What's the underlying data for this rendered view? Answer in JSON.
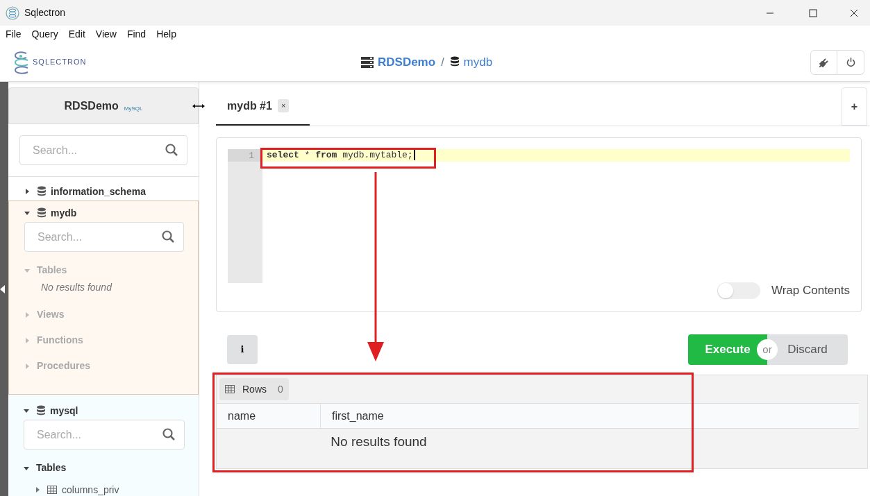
{
  "window": {
    "title": "Sqlectron"
  },
  "menu": [
    "File",
    "Query",
    "Edit",
    "View",
    "Find",
    "Help"
  ],
  "header": {
    "logo_text": "SQLECTRON",
    "breadcrumb": [
      {
        "label": "RDSDemo",
        "kind": "server"
      },
      {
        "label": "mydb",
        "kind": "database"
      }
    ],
    "separator": "/"
  },
  "sidebar": {
    "server": "RDSDemo",
    "db_logo": "MySQL",
    "search": {
      "placeholder": "Search..."
    },
    "databases": [
      {
        "name": "information_schema",
        "expanded": false,
        "selected": false,
        "hovered": false
      },
      {
        "name": "mydb",
        "expanded": true,
        "selected": true,
        "hovered": false,
        "search": {
          "placeholder": "Search..."
        },
        "children": [
          {
            "label": "Tables",
            "expanded": true,
            "disabled": true,
            "empty_text": "No results found"
          },
          {
            "label": "Views",
            "expanded": false,
            "disabled": true
          },
          {
            "label": "Functions",
            "expanded": false,
            "disabled": true
          },
          {
            "label": "Procedures",
            "expanded": false,
            "disabled": true
          }
        ]
      },
      {
        "name": "mysql",
        "expanded": true,
        "selected": false,
        "hovered": true,
        "search": {
          "placeholder": "Search..."
        },
        "children": [
          {
            "label": "Tables",
            "expanded": true,
            "disabled": false,
            "children": [
              {
                "label": "columns_priv",
                "expanded": false
              }
            ]
          }
        ]
      }
    ]
  },
  "tabs": [
    {
      "label": "mydb #1",
      "selected": true,
      "close": "×"
    }
  ],
  "new_tab": "+",
  "editor": {
    "lines": [
      {
        "number": "1",
        "code": "**select** * **from** mydb.mytable;",
        "active": true
      }
    ],
    "wrap_contents": {
      "label": "Wrap Contents",
      "on": false
    }
  },
  "actions": {
    "info": "i",
    "execute": "Execute",
    "or": "or",
    "discard": "Discard"
  },
  "results": {
    "rows_label": "Rows",
    "rows_count": "0",
    "columns": [
      "name",
      "first_name"
    ],
    "empty_text": "No results found"
  }
}
